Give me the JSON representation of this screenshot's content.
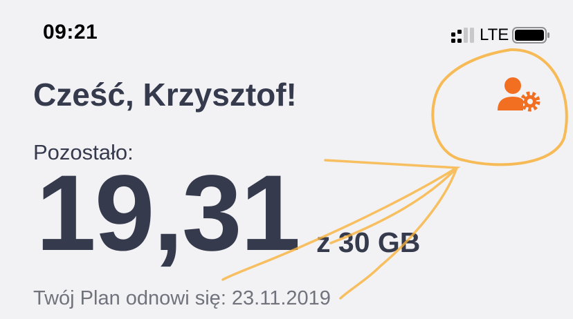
{
  "status_bar": {
    "time": "09:21",
    "network": "LTE",
    "icons": [
      "signal-icon",
      "battery-icon"
    ]
  },
  "greeting": "Cześć, Krzysztof!",
  "usage": {
    "remaining_label": "Pozostało:",
    "remaining_value": "19,31",
    "quota": "z 30 GB"
  },
  "plan": {
    "renewal_text": "Twój Plan odnowi się: 23.11.2019"
  },
  "header_icon": "profile-settings-icon",
  "colors": {
    "accent": "#f26f21",
    "text_primary": "#363a4d",
    "text_secondary": "#70727c",
    "annotation": "#f7b23b",
    "background": "#f2f2f4"
  }
}
